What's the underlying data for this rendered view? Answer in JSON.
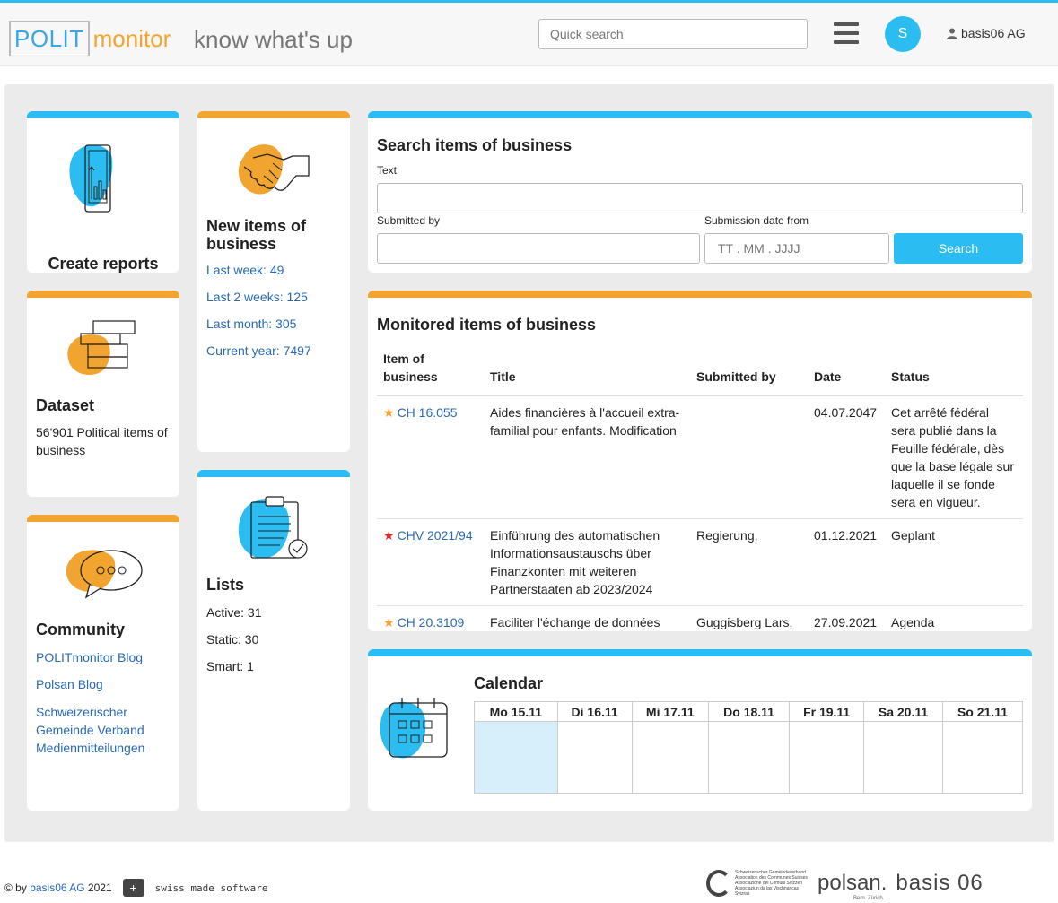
{
  "header": {
    "logo_polit": "POLIT",
    "logo_monitor": "monitor",
    "tagline": "know what's up",
    "search_placeholder": "Quick search",
    "avatar_initial": "S",
    "user_name": "basis06 AG"
  },
  "reports": {
    "title": "Create reports"
  },
  "new_items": {
    "title": "New items of business",
    "links": [
      "Last week: 49",
      "Last 2 weeks: 125",
      "Last month: 305",
      "Current year: 7497"
    ]
  },
  "dataset": {
    "title": "Dataset",
    "text": "56'901 Political items of business"
  },
  "lists": {
    "title": "Lists",
    "items": [
      "Active: 31",
      "Static: 30",
      "Smart: 1"
    ]
  },
  "community": {
    "title": "Community",
    "links": [
      "POLITmonitor Blog",
      "Polsan Blog",
      "Schweizerischer Gemeinde Verband Medienmitteilungen"
    ]
  },
  "search": {
    "title": "Search items of business",
    "text_label": "Text",
    "submitted_label": "Submitted by",
    "date_label": "Submission date from",
    "date_placeholder": "TT . MM . JJJJ",
    "button": "Search"
  },
  "monitored": {
    "title": "Monitored items of business",
    "columns": [
      "Item of business",
      "Title",
      "Submitted by",
      "Date",
      "Status"
    ],
    "rows": [
      {
        "star_color": "#f2a431",
        "id": "CH 16.055",
        "title": "Aides financières à l'accueil extra-familial pour enfants. Modification",
        "submitted": "",
        "date": "04.07.2047",
        "status": "Cet arrêté fédéral sera publié dans la Feuille fédérale, dès que la base légale sur laquelle il se fonde sera en vigueur."
      },
      {
        "star_color": "#e8242a",
        "id": "CHV 2021/94",
        "title": "Einführung des automatischen Informationsaustauschs über Finanzkonten mit weiteren Partnerstaaten ab 2023/2024",
        "submitted": "Regierung,",
        "date": "01.12.2021",
        "status": "Geplant"
      },
      {
        "star_color": "#f2a431",
        "id": "CH 20.3109",
        "title": "Faciliter l'échange de données",
        "submitted": "Guggisberg Lars,",
        "date": "27.09.2021",
        "status": "Agenda"
      }
    ]
  },
  "calendar": {
    "title": "Calendar",
    "days": [
      "Mo 15.11",
      "Di 16.11",
      "Mi 17.11",
      "Do 18.11",
      "Fr 19.11",
      "Sa 20.11",
      "So 21.11"
    ]
  },
  "footer": {
    "copy_prefix": "© by",
    "company_link": "basis06 AG",
    "year": "2021",
    "swiss": "swiss made software",
    "sgv_lines": [
      "Schweizerischer Gemeindeverband",
      "Association des Communes Suisses",
      "Associazione dei Comuni Svizzeri",
      "Associaziun da las Vischnancas Svizras"
    ],
    "polsan": "polsan.",
    "polsan_sub": "Bern. Zürich.",
    "basis": "basis 06"
  },
  "colors": {
    "accent_blue": "#2bbdf2",
    "accent_orange": "#f2a431",
    "link": "#2a6ab3"
  }
}
